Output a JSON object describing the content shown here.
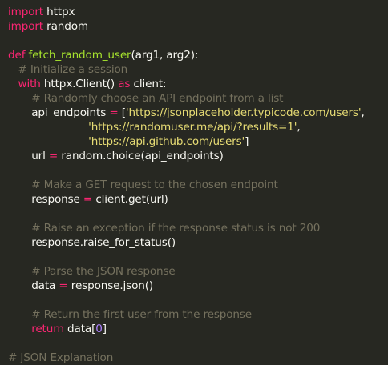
{
  "editor": {
    "lines": [
      [
        {
          "t": "import",
          "c": "kw"
        },
        {
          "t": " httpx",
          "c": "txt"
        }
      ],
      [
        {
          "t": "import",
          "c": "kw"
        },
        {
          "t": " random",
          "c": "txt"
        }
      ],
      [],
      [
        {
          "t": "def ",
          "c": "kw"
        },
        {
          "t": "fetch_random_user",
          "c": "fn"
        },
        {
          "t": "(arg1, arg2):",
          "c": "txt"
        }
      ],
      [
        {
          "t": "   ",
          "c": "txt"
        },
        {
          "t": "# Initialize a session",
          "c": "cm"
        }
      ],
      [
        {
          "t": "   ",
          "c": "txt"
        },
        {
          "t": "with",
          "c": "kw"
        },
        {
          "t": " httpx.Client() ",
          "c": "txt"
        },
        {
          "t": "as",
          "c": "kw"
        },
        {
          "t": " client:",
          "c": "txt"
        }
      ],
      [
        {
          "t": "       ",
          "c": "txt"
        },
        {
          "t": "# Randomly choose an API endpoint from a list",
          "c": "cm"
        }
      ],
      [
        {
          "t": "       api_endpoints ",
          "c": "txt"
        },
        {
          "t": "=",
          "c": "op"
        },
        {
          "t": " [",
          "c": "txt"
        },
        {
          "t": "'https://jsonplaceholder.typicode.com/users'",
          "c": "str"
        },
        {
          "t": ",",
          "c": "txt"
        }
      ],
      [
        {
          "t": "                        ",
          "c": "txt"
        },
        {
          "t": "'https://randomuser.me/api/?results=1'",
          "c": "str"
        },
        {
          "t": ",",
          "c": "txt"
        }
      ],
      [
        {
          "t": "                        ",
          "c": "txt"
        },
        {
          "t": "'https://api.github.com/users'",
          "c": "str"
        },
        {
          "t": "]",
          "c": "txt"
        }
      ],
      [
        {
          "t": "       url ",
          "c": "txt"
        },
        {
          "t": "=",
          "c": "op"
        },
        {
          "t": " random.choice(api_endpoints)",
          "c": "txt"
        }
      ],
      [],
      [
        {
          "t": "       ",
          "c": "txt"
        },
        {
          "t": "# Make a GET request to the chosen endpoint",
          "c": "cm"
        }
      ],
      [
        {
          "t": "       response ",
          "c": "txt"
        },
        {
          "t": "=",
          "c": "op"
        },
        {
          "t": " client.get(url)",
          "c": "txt"
        }
      ],
      [],
      [
        {
          "t": "       ",
          "c": "txt"
        },
        {
          "t": "# Raise an exception if the response status is not 200",
          "c": "cm"
        }
      ],
      [
        {
          "t": "       response.raise_for_status()",
          "c": "txt"
        }
      ],
      [],
      [
        {
          "t": "       ",
          "c": "txt"
        },
        {
          "t": "# Parse the JSON response",
          "c": "cm"
        }
      ],
      [
        {
          "t": "       data ",
          "c": "txt"
        },
        {
          "t": "=",
          "c": "op"
        },
        {
          "t": " response.json()",
          "c": "txt"
        }
      ],
      [],
      [
        {
          "t": "       ",
          "c": "txt"
        },
        {
          "t": "# Return the first user from the response",
          "c": "cm"
        }
      ],
      [
        {
          "t": "       ",
          "c": "txt"
        },
        {
          "t": "return",
          "c": "kw"
        },
        {
          "t": " data[",
          "c": "txt"
        },
        {
          "t": "0",
          "c": "num"
        },
        {
          "t": "]",
          "c": "txt"
        }
      ],
      [],
      [
        {
          "t": "# JSON Explanation",
          "c": "cm"
        }
      ]
    ],
    "colors": {
      "background": "#272822",
      "keyword": "#f92672",
      "function": "#a6e22e",
      "string": "#e6db74",
      "comment": "#75715e",
      "number": "#ae81ff",
      "text": "#f8f8f2"
    }
  }
}
